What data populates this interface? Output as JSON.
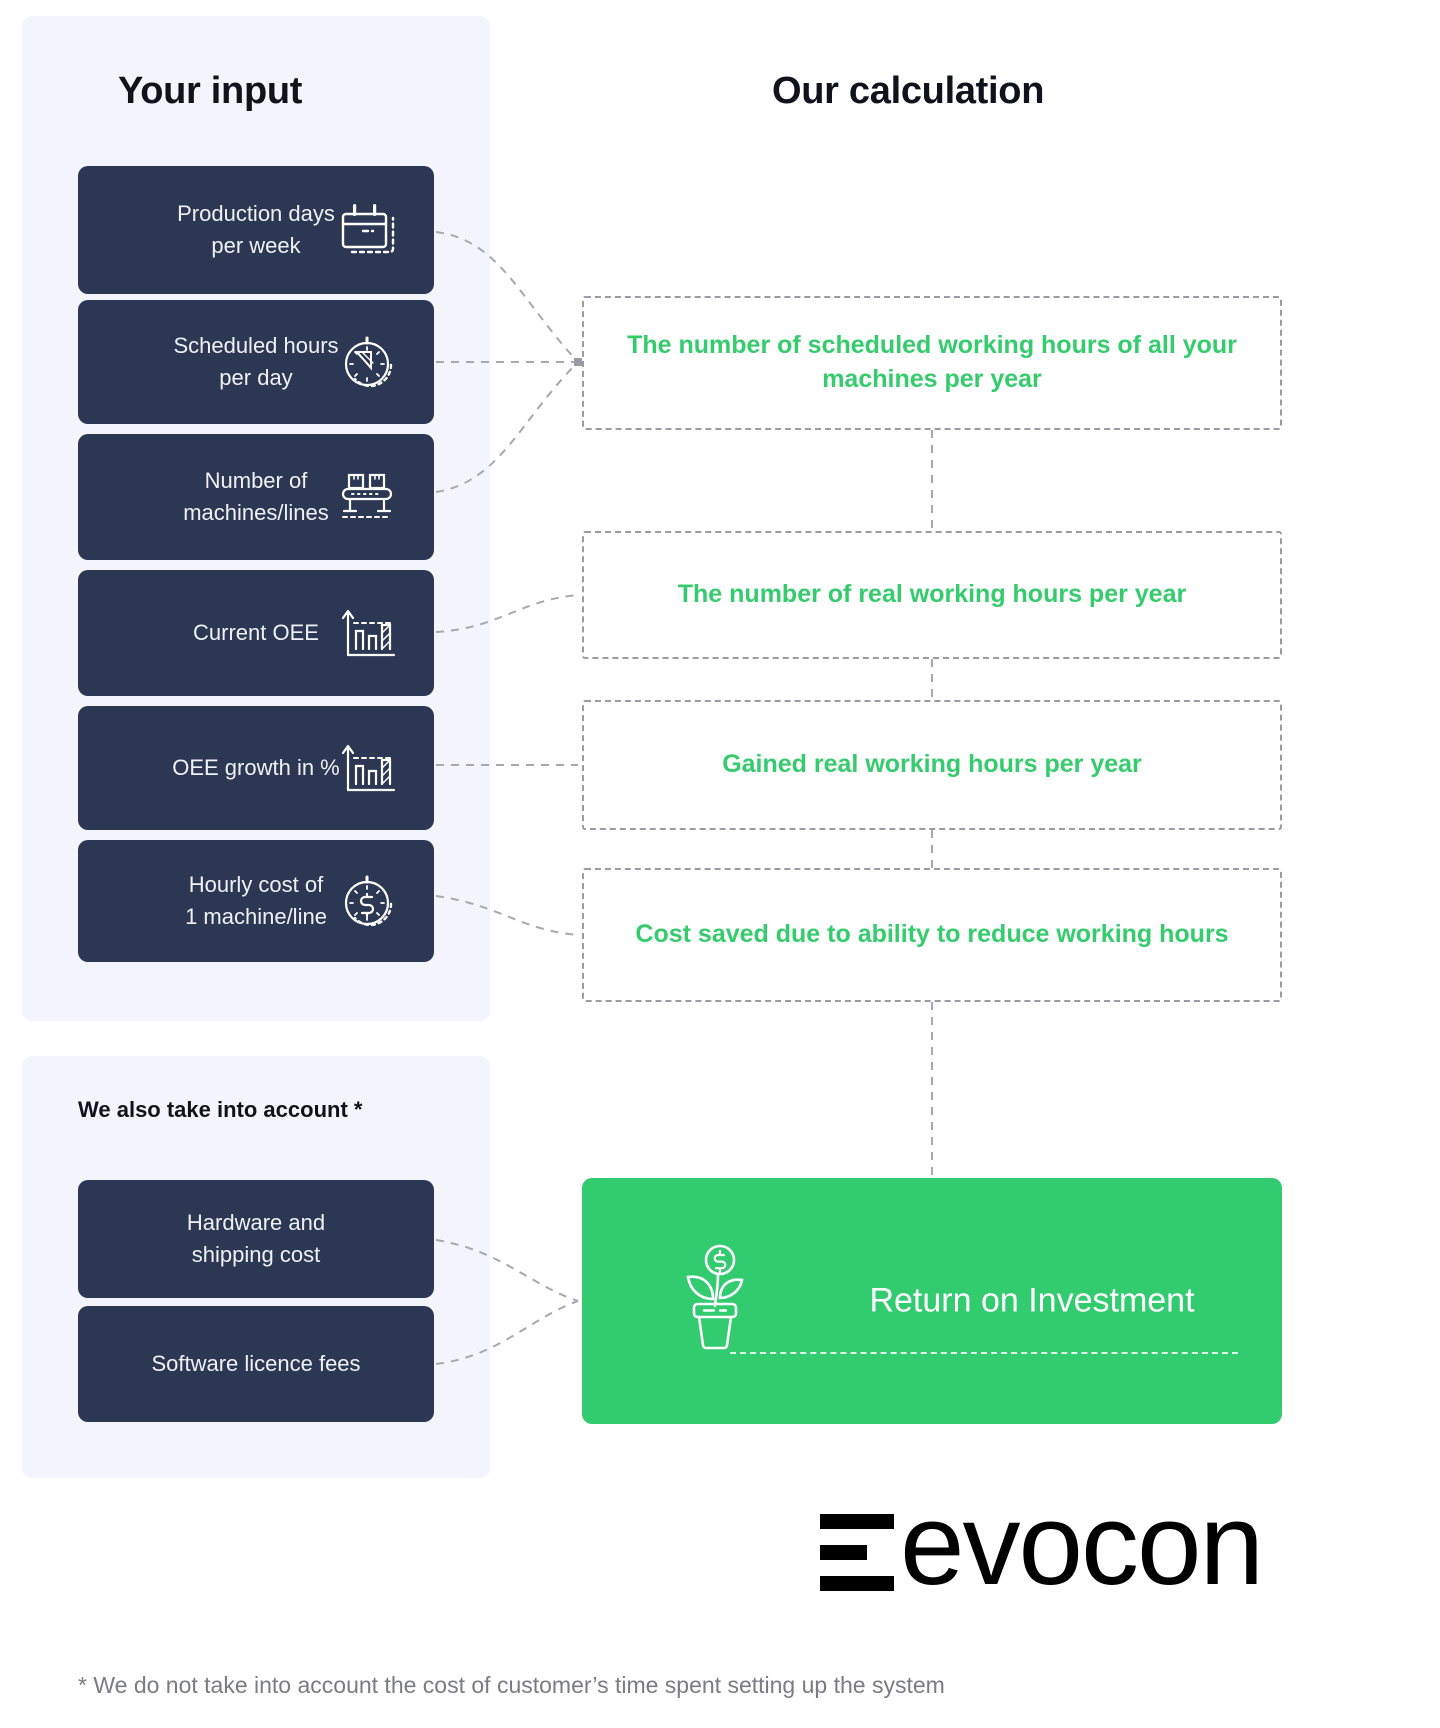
{
  "headings": {
    "input": "Your input",
    "calculation": "Our calculation",
    "also_account": "We also take into account *"
  },
  "input_cards": [
    {
      "label": "Production days\nper week",
      "icon": "calendar-icon"
    },
    {
      "label": "Scheduled hours\nper day",
      "icon": "stopwatch-icon"
    },
    {
      "label": "Number of\nmachines/lines",
      "icon": "conveyor-icon"
    },
    {
      "label": "Current OEE",
      "icon": "bar-chart-growth-icon"
    },
    {
      "label": "OEE growth in %",
      "icon": "bar-chart-growth-icon"
    },
    {
      "label": "Hourly cost of\n1 machine/line",
      "icon": "dollar-stopwatch-icon"
    }
  ],
  "extra_cards": [
    {
      "label": "Hardware and\nshipping cost"
    },
    {
      "label": "Software licence fees"
    }
  ],
  "calculations": [
    "The number of scheduled working hours of all your machines per year",
    "The number of real working hours per year",
    "Gained real working hours per year",
    "Cost saved due to ability to reduce working hours"
  ],
  "result": {
    "label": "Return on Investment",
    "icon": "money-plant-icon"
  },
  "footnote": "* We do not take into account the cost of customer’s time spent setting up the system",
  "logo": {
    "text": "evocon",
    "mark": "evocon-bars-icon"
  },
  "colors": {
    "panel_background": "#f4f4fd",
    "card_background": "#2c3753",
    "accent_green": "#32cb70",
    "calc_text_green": "#35cc6e",
    "dashed_border": "#9b9ba5",
    "heading_text": "#10131c",
    "footnote_text": "#7b7b83"
  }
}
